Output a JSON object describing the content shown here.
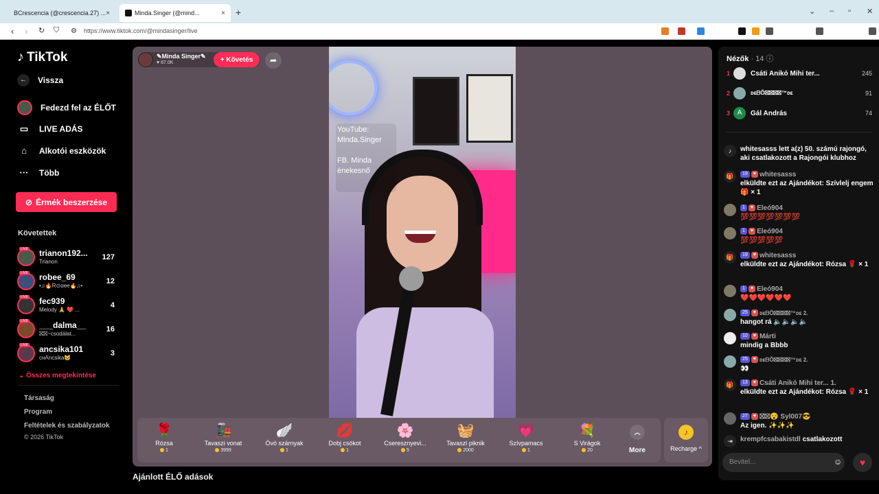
{
  "browser": {
    "tabs": [
      {
        "label": "BCrescencia (@crescencia.27) ..."
      },
      {
        "label": "Minda.Singer (@mind..."
      }
    ],
    "new_tab": "+",
    "url": "https://www.tiktok.com/@mindasinger/live"
  },
  "sidebar": {
    "logo": "TikTok",
    "back": "Vissza",
    "menu": [
      {
        "label": "Fedezd fel az ÉLŐT",
        "icon": "live-discover-icon"
      },
      {
        "label": "LIVE ADÁS",
        "icon": "camera-icon"
      },
      {
        "label": "Alkotói eszközök",
        "icon": "home-icon"
      },
      {
        "label": "Több",
        "icon": "more-icon"
      }
    ],
    "coins_button": "Érmék beszerzése",
    "following_title": "Követettek",
    "following": [
      {
        "name": "trianon192...",
        "sub": "Trianon",
        "count": "127"
      },
      {
        "name": "robee_69",
        "sub": "•♫🔥R⊙ɑee🔥♫•",
        "count": "12"
      },
      {
        "name": "fec939",
        "sub": "Melody 🙏 ❤️ ...",
        "count": "4"
      },
      {
        "name": "___dalma__",
        "sub": "⛝⛝~csodálat...",
        "count": "16"
      },
      {
        "name": "ancsika101",
        "sub": "cнAncsika😺",
        "count": "3"
      }
    ],
    "see_all": "Összes megtekintése",
    "footer": [
      "Társaság",
      "Program",
      "Feltételek és szabályzatok",
      "© 2026 TikTok"
    ]
  },
  "stage": {
    "host_name": "✎Minda Singer✎",
    "host_likes": "87.0K",
    "follow_label": "+ Követés",
    "video_text_line1": "YouTube:",
    "video_text_line2": "Minda.Singer",
    "video_text_line3": "FB. Minda",
    "video_text_line4": "énekesnő",
    "gifts": [
      {
        "name": "Rózsa",
        "price": "1",
        "icon": "🌹"
      },
      {
        "name": "Tavaszi vonat",
        "price": "3999",
        "icon": "🚂"
      },
      {
        "name": "Óvó szárnyak",
        "price": "1",
        "icon": "🪽"
      },
      {
        "name": "Dobj csókot",
        "price": "1",
        "icon": "💋"
      },
      {
        "name": "Cseresznyevi...",
        "price": "5",
        "icon": "🌸"
      },
      {
        "name": "Tavaszi piknik",
        "price": "2000",
        "icon": "🧺"
      },
      {
        "name": "Szívpamacs",
        "price": "1",
        "icon": "💗"
      },
      {
        "name": "S Virágok",
        "price": "20",
        "icon": "💐"
      }
    ],
    "more_label": "More",
    "recharge_label": "Recharge ^",
    "below_title": "Ajánlott ÉLŐ adások"
  },
  "chat": {
    "viewers_title": "Nézők",
    "viewers_count": "· 14",
    "viewers": [
      {
        "rank": "1",
        "name": "Csáti Anikó Mihi ter...",
        "count": "245"
      },
      {
        "rank": "2",
        "name": "ᴅᴇᗷÕ⛝⛝⛝⛝™ᴅᴇ",
        "count": "91"
      },
      {
        "rank": "3",
        "name": "Gál András",
        "count": "74"
      }
    ],
    "messages": [
      {
        "badges": "",
        "user": "",
        "text": "whitesasss lett a(z) 50. számú rajongó, aki csatlakozott a Rajongói klubhoz"
      },
      {
        "badges": "19",
        "user": "whitesasss",
        "text": "elküldte ezt az Ajándékot: Szívlelj engem 🎁 × 1"
      },
      {
        "badges": "1",
        "user": "Eleó904",
        "text": "💯💯💯💯💯💯💯"
      },
      {
        "badges": "1",
        "user": "Eleó904",
        "text": "💯💯💯💯💯"
      },
      {
        "badges": "19",
        "user": "whitesasss",
        "text": "elküldte ezt az Ajándékot: Rózsa 🌹 × 1"
      },
      {
        "badges": "1",
        "user": "Eleó904",
        "text": "❤️❤️❤️❤️❤️❤️"
      },
      {
        "badges": "25",
        "user": "ᴅᴇᗷÕ⛝⛝⛝⛝™ᴅᴇ 2.",
        "text": "hangot rá 🔈🔈🔈🔈"
      },
      {
        "badges": "10",
        "user": "Márti",
        "text": "mindig a Bbbb"
      },
      {
        "badges": "25",
        "user": "ᴅᴇᗷÕ⛝⛝⛝⛝™ᴅᴇ 2.",
        "text": "👀"
      },
      {
        "badges": "13",
        "user": "Csáti Anikó Mihi ter... 1.",
        "text": "elküldte ezt az Ajándékot: Rózsa 🌹 × 1"
      },
      {
        "badges": "27",
        "user": "⛝⛝😵 Syl007😎",
        "text": "Az igen. ✨✨✨"
      },
      {
        "badges": "",
        "user": "krempfcsabakistdl",
        "text": "csatlakozott"
      }
    ],
    "input_placeholder": "Bevitel..."
  }
}
